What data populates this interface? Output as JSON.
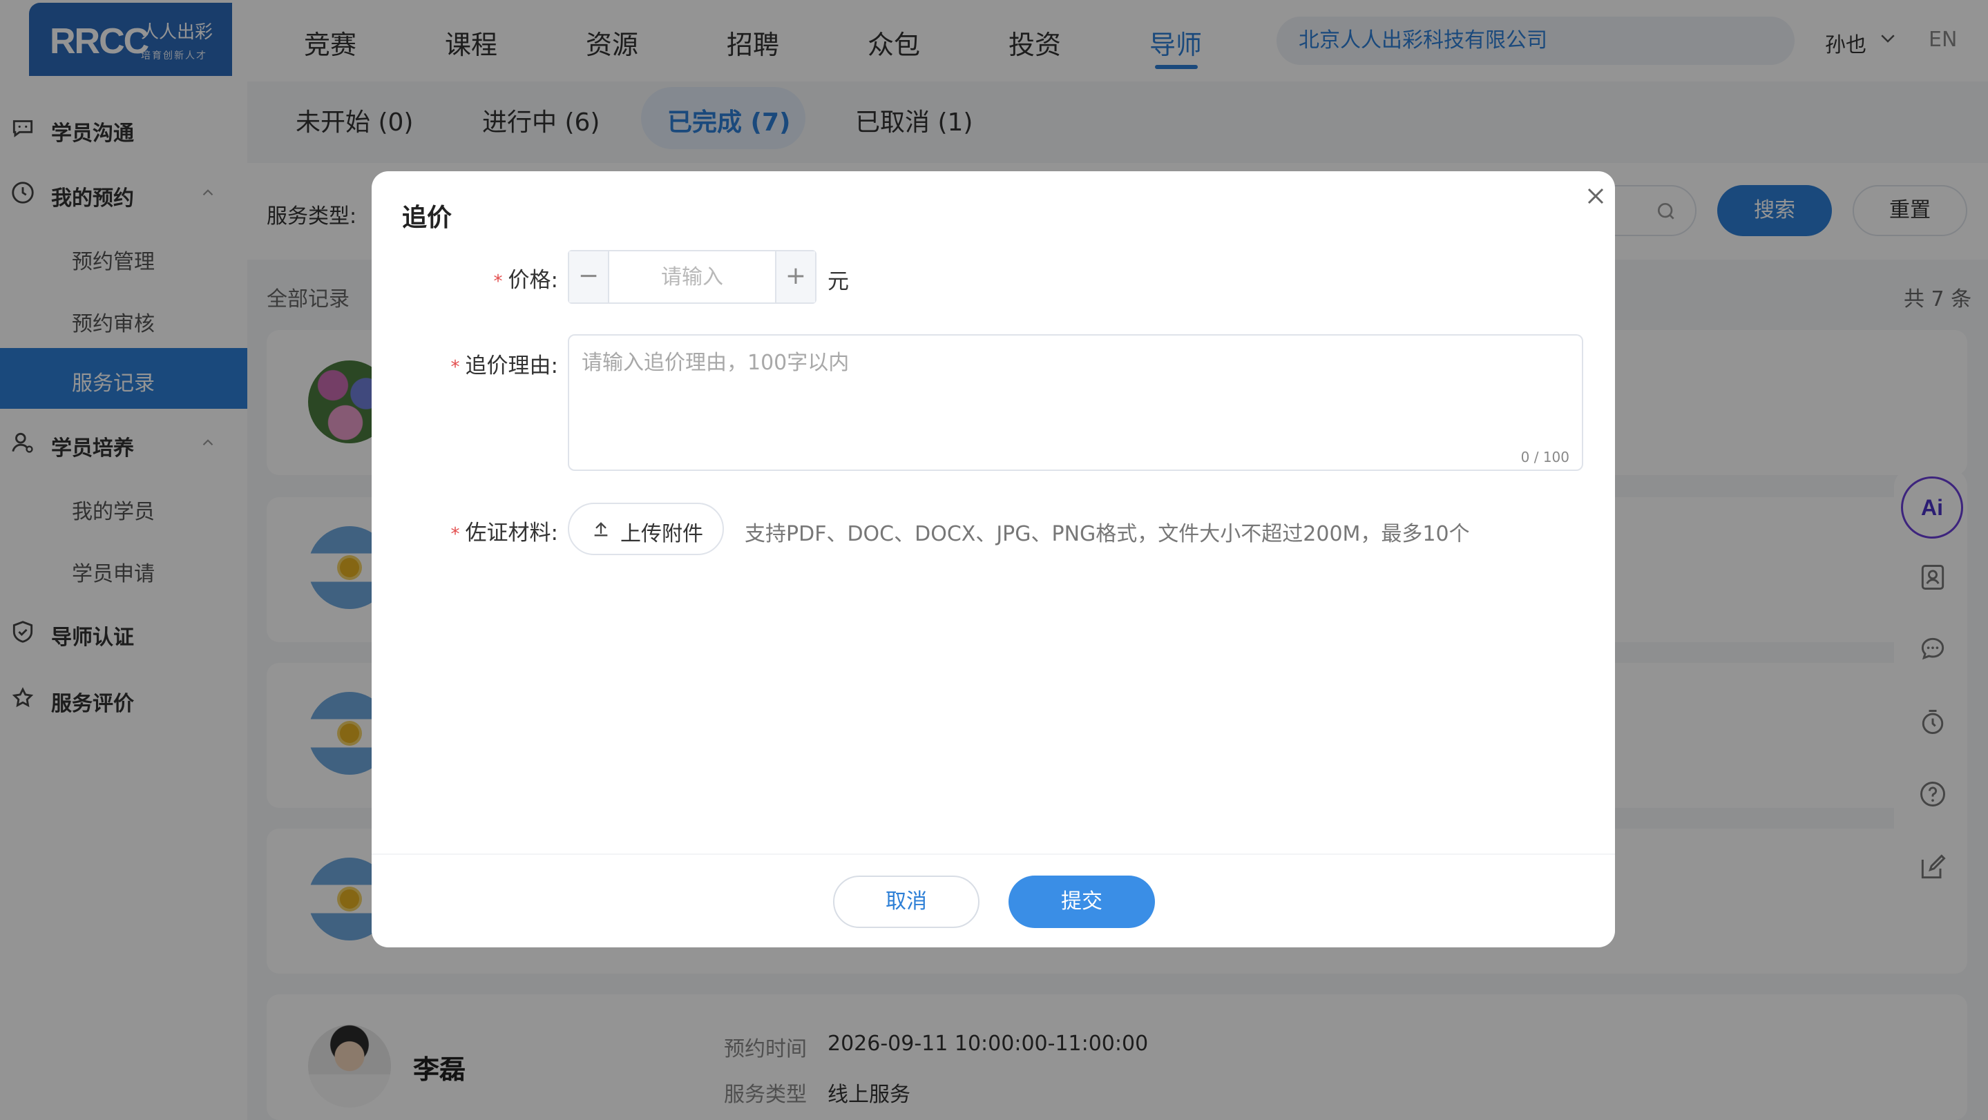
{
  "header": {
    "logo_mark": "RRCC",
    "logo_cn": "人人出彩",
    "logo_sub": "培育创新人才",
    "nav": [
      "竞赛",
      "课程",
      "资源",
      "招聘",
      "众包",
      "投资",
      "导师"
    ],
    "active_nav": "导师",
    "company": "北京人人出彩科技有限公司",
    "user": "孙也",
    "lang": "EN"
  },
  "sidebar": {
    "items": [
      {
        "label": "学员沟通",
        "icon": "chat-icon"
      },
      {
        "label": "我的预约",
        "icon": "clock-icon",
        "expanded": true,
        "children": [
          "预约管理",
          "预约审核",
          "服务记录"
        ]
      },
      {
        "label": "学员培养",
        "icon": "user-icon",
        "expanded": true,
        "children": [
          "我的学员",
          "学员申请"
        ]
      },
      {
        "label": "导师认证",
        "icon": "shield-icon"
      },
      {
        "label": "服务评价",
        "icon": "rating-icon"
      }
    ],
    "active_child": "服务记录"
  },
  "tabs": [
    "未开始 (0)",
    "进行中 (6)",
    "已完成 (7)",
    "已取消 (1)"
  ],
  "active_tab": "已完成 (7)",
  "filters": {
    "service_type_label": "服务类型:",
    "search_button": "搜索",
    "reset_button": "重置"
  },
  "list": {
    "all_records": "全部记录",
    "total": "共 7 条",
    "last_card": {
      "name": "李磊",
      "time_label": "预约时间",
      "time_value": "2026-09-11 10:00:00-11:00:00",
      "type_label": "服务类型",
      "type_value": "线上服务"
    }
  },
  "floating": {
    "ai_label": "Ai"
  },
  "modal": {
    "title": "追价",
    "required_mark": "*",
    "price_label": "价格:",
    "price_placeholder": "请输入",
    "price_minus": "−",
    "price_plus": "+",
    "unit": "元",
    "reason_label": "追价理由:",
    "reason_placeholder": "请输入追价理由，100字以内",
    "reason_counter": "0 / 100",
    "evidence_label": "佐证材料:",
    "upload_button": "上传附件",
    "upload_hint": "支持PDF、DOC、DOCX、JPG、PNG格式，文件大小不超过200M，最多10个",
    "cancel_button": "取消",
    "submit_button": "提交"
  },
  "colors": {
    "accent": "#2d7fd6",
    "required": "#e34d4d",
    "overlay": "rgba(0,0,0,0.42)"
  }
}
